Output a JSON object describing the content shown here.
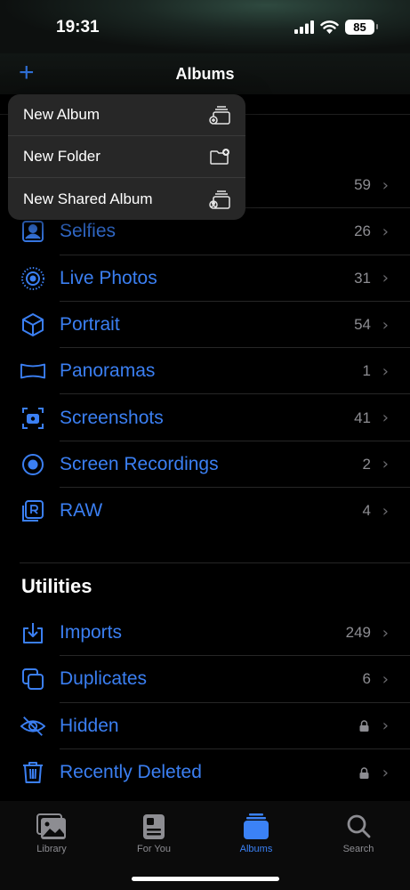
{
  "status": {
    "time": "19:31",
    "battery": "85"
  },
  "nav": {
    "add": "+",
    "title": "Albums"
  },
  "popover": {
    "items": [
      {
        "label": "New Album"
      },
      {
        "label": "New Folder"
      },
      {
        "label": "New Shared Album"
      }
    ]
  },
  "media_types": [
    {
      "label": "",
      "count": "59"
    },
    {
      "label": "Selfies",
      "count": "26"
    },
    {
      "label": "Live Photos",
      "count": "31"
    },
    {
      "label": "Portrait",
      "count": "54"
    },
    {
      "label": "Panoramas",
      "count": "1"
    },
    {
      "label": "Screenshots",
      "count": "41"
    },
    {
      "label": "Screen Recordings",
      "count": "2"
    },
    {
      "label": "RAW",
      "count": "4"
    }
  ],
  "utilities": {
    "title": "Utilities",
    "items": [
      {
        "label": "Imports",
        "count": "249"
      },
      {
        "label": "Duplicates",
        "count": "6"
      },
      {
        "label": "Hidden",
        "count": ""
      },
      {
        "label": "Recently Deleted",
        "count": ""
      }
    ]
  },
  "tabs": [
    {
      "label": "Library"
    },
    {
      "label": "For You"
    },
    {
      "label": "Albums"
    },
    {
      "label": "Search"
    }
  ],
  "colors": {
    "accent": "#3b7ff2",
    "background": "#000000",
    "popover": "#272727"
  }
}
